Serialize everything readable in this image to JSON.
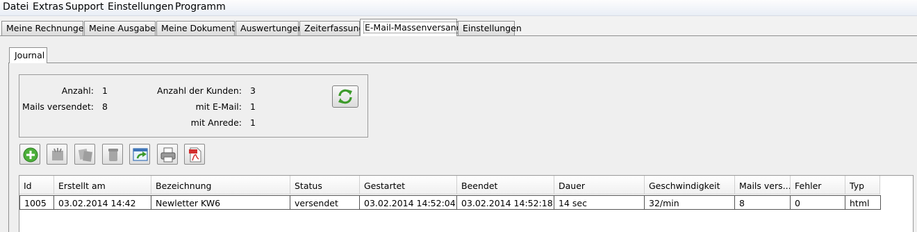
{
  "menu": [
    "Datei",
    "Extras",
    "Support",
    "Einstellungen",
    "Programm"
  ],
  "tabs": [
    {
      "label": "Meine Rechnungen"
    },
    {
      "label": "Meine Ausgaben"
    },
    {
      "label": "Meine Dokumente"
    },
    {
      "label": "Auswertungen"
    },
    {
      "label": "Zeiterfassung"
    },
    {
      "label": "E-Mail-Massenversand",
      "active": true
    },
    {
      "label": "Einstellungen"
    }
  ],
  "subtab": "Journal",
  "stats": {
    "anzahl_label": "Anzahl:",
    "anzahl": "1",
    "mails_label": "Mails versendet:",
    "mails": "8",
    "kunden_label": "Anzahl der Kunden:",
    "kunden": "3",
    "email_label": "mit E-Mail:",
    "email": "1",
    "anrede_label": "mit Anrede:",
    "anrede": "1"
  },
  "toolbar": [
    {
      "icon": "add-icon",
      "enabled": true
    },
    {
      "icon": "edit-icon",
      "enabled": false
    },
    {
      "icon": "copy-icon",
      "enabled": false
    },
    {
      "icon": "delete-icon",
      "enabled": false
    },
    {
      "icon": "export-icon",
      "enabled": true
    },
    {
      "icon": "printer-icon",
      "enabled": true
    },
    {
      "icon": "pdf-icon",
      "enabled": true
    }
  ],
  "table": {
    "columns": [
      "Id",
      "Erstellt am",
      "Bezeichnung",
      "Status",
      "Gestartet",
      "Beendet",
      "Dauer",
      "Geschwindigkeit",
      "Mails vers...",
      "Fehler",
      "Typ"
    ],
    "rows": [
      [
        "1005",
        "03.02.2014 14:42",
        "Newletter KW6",
        "versendet",
        "03.02.2014 14:52:04",
        "03.02.2014 14:52:18",
        "14 sec",
        "32/min",
        "8",
        "0",
        "html"
      ]
    ]
  }
}
